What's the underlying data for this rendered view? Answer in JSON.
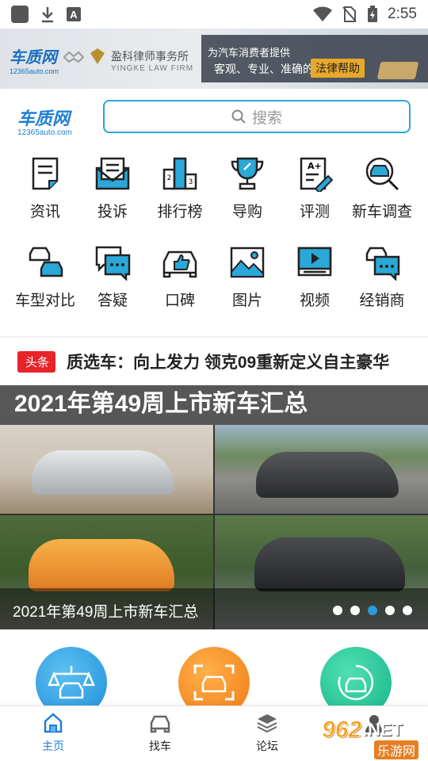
{
  "status_bar": {
    "time": "2:55"
  },
  "banner": {
    "site_logo": "车质网",
    "site_domain": "12365auto.com",
    "law_firm_cn": "盈科律师事务所",
    "law_firm_en": "YINGKE LAW FIRM",
    "line1": "为汽车消费者提供",
    "line2": "客观、专业、准确的",
    "tag": "法律帮助"
  },
  "header": {
    "logo": "车质网",
    "domain": "12365auto.com",
    "search_placeholder": "搜索"
  },
  "grid": {
    "items": [
      {
        "label": "资讯",
        "icon": "news-icon"
      },
      {
        "label": "投诉",
        "icon": "complaint-icon"
      },
      {
        "label": "排行榜",
        "icon": "ranking-icon"
      },
      {
        "label": "导购",
        "icon": "trophy-icon"
      },
      {
        "label": "评测",
        "icon": "review-icon"
      },
      {
        "label": "新车调查",
        "icon": "car-search-icon"
      },
      {
        "label": "车型对比",
        "icon": "compare-icon"
      },
      {
        "label": "答疑",
        "icon": "chat-icon"
      },
      {
        "label": "口碑",
        "icon": "thumbs-up-car-icon"
      },
      {
        "label": "图片",
        "icon": "image-icon"
      },
      {
        "label": "视频",
        "icon": "video-icon"
      },
      {
        "label": "经销商",
        "icon": "dealer-icon"
      }
    ]
  },
  "headline": {
    "badge": "头条",
    "text": "质选车：向上发力 领克09重新定义自主豪华"
  },
  "carousel": {
    "title": "2021年第49周上市新车汇总",
    "caption": "2021年第49周上市新车汇总",
    "slide_count": 5,
    "active_index": 2
  },
  "bottom_nav": {
    "items": [
      {
        "label": "主页",
        "icon": "home-icon",
        "active": true
      },
      {
        "label": "找车",
        "icon": "car-icon",
        "active": false
      },
      {
        "label": "论坛",
        "icon": "layers-icon",
        "active": false
      },
      {
        "label": "",
        "icon": "profile-icon",
        "active": false
      }
    ]
  },
  "watermark": {
    "brand": "962",
    "suffix": ".NET",
    "name": "乐游网"
  },
  "colors": {
    "accent": "#1e7fd6",
    "search_border": "#2aa8d8",
    "badge_red": "#e8232a",
    "banner_tag": "#e8a82a"
  }
}
